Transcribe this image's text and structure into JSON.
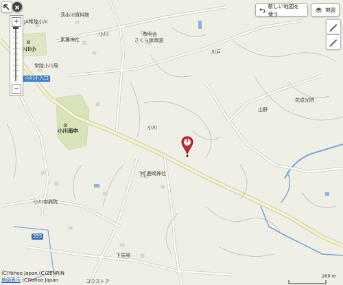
{
  "toolbar": {
    "new_map_label": "新しい地図を使う",
    "map_label": "地図"
  },
  "zoom": {
    "plus": "+",
    "minus": "−"
  },
  "marker": {
    "number": "1"
  },
  "labels": {
    "ja_ogawa": "JA常陸小川",
    "kominkan": "茨小川資料館",
    "ogawa_top": "小川",
    "ogawa_elem": "小川小",
    "shrine1": "素鵞神社",
    "hitachi_ogawa": "常陸小川局",
    "ogawa_entrance": "小川小入口",
    "kawado": "川戸",
    "nursery1": "恭明会",
    "nursery2": "さくら保育園",
    "yamano": "山野",
    "hanazono": "花成光院",
    "ogawa_jhs": "小川南中",
    "ogawa_mid": "小川",
    "shrine2": "鹿嶋神社",
    "hospital": "小川南病院",
    "route": "355",
    "shimobaba": "下馬場",
    "costco": "コウストア"
  },
  "copyright": {
    "line1": "(C)Yahoo Japan,(C)ZENRIN",
    "line2": "(C)Yahoo Japan",
    "line2_prefix": "地図表示"
  },
  "scale": {
    "label": "200 m"
  },
  "colors": {
    "land": "#efefe6",
    "road": "#ffffff",
    "road_edge": "#c9c8bd",
    "main_road": "#f6f3c6",
    "river": "#6f9fd6",
    "park": "#d8e2b7",
    "marker": "#d0242e"
  }
}
